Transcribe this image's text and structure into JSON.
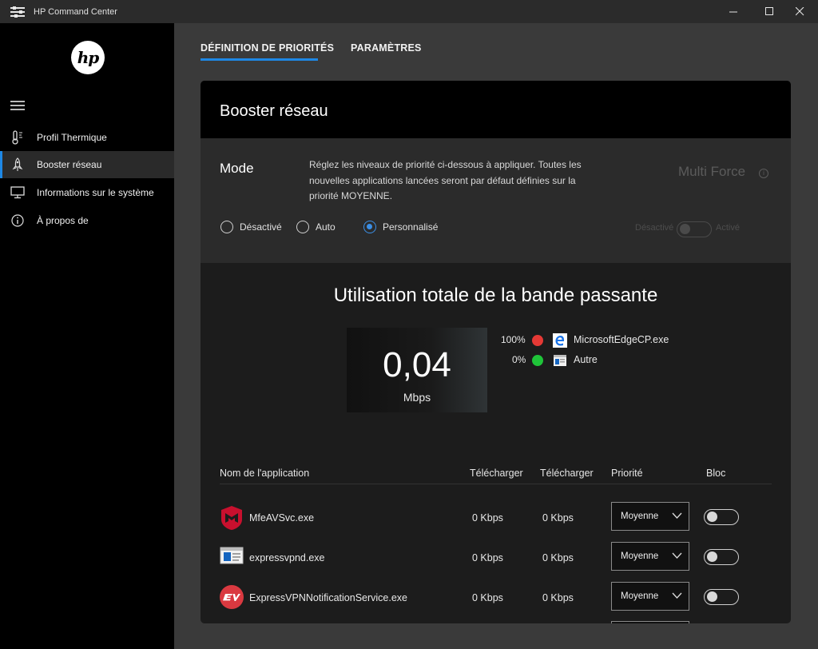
{
  "window": {
    "title": "HP Command Center"
  },
  "sidebar": {
    "logo_text": "hp",
    "items": [
      {
        "label": "Profil Thermique",
        "icon": "thermometer-icon"
      },
      {
        "label": "Booster réseau",
        "icon": "rocket-icon"
      },
      {
        "label": "Informations sur le système",
        "icon": "monitor-icon"
      },
      {
        "label": "À propos de",
        "icon": "info-icon"
      }
    ]
  },
  "tabs": [
    {
      "label": "DÉFINITION DE PRIORITÉS",
      "active": true
    },
    {
      "label": "PARAMÈTRES",
      "active": false
    }
  ],
  "card": {
    "title": "Booster réseau",
    "mode": {
      "title": "Mode",
      "description": "Réglez les niveaux de priorité ci-dessous à appliquer. Toutes les nouvelles applications lancées seront par défaut définies sur la priorité MOYENNE.",
      "options": [
        "Désactivé",
        "Auto",
        "Personnalisé"
      ],
      "selected": "Personnalisé"
    },
    "multi_force": {
      "title": "Multi Force",
      "off_label": "Désactivé",
      "on_label": "Activé",
      "info_glyph": "i"
    },
    "bandwidth": {
      "title": "Utilisation totale de la bande passante",
      "value": "0,04",
      "unit": "Mbps",
      "legend": [
        {
          "percent": "100%",
          "color": "#e53935",
          "name": "MicrosoftEdgeCP.exe",
          "icon": "edge-icon"
        },
        {
          "percent": "0%",
          "color": "#1fc439",
          "name": "Autre",
          "icon": "window-icon"
        }
      ]
    },
    "table": {
      "headers": [
        "Nom de l'application",
        "Télécharger",
        "Télécharger",
        "Priorité",
        "Bloc"
      ],
      "rows": [
        {
          "name": "MfeAVSvc.exe",
          "down": "0 Kbps",
          "up": "0 Kbps",
          "priority": "Moyenne",
          "icon": "mcafee-icon"
        },
        {
          "name": "expressvpnd.exe",
          "down": "0 Kbps",
          "up": "0 Kbps",
          "priority": "Moyenne",
          "icon": "window-icon"
        },
        {
          "name": "ExpressVPNNotificationService.exe",
          "down": "0 Kbps",
          "up": "0 Kbps",
          "priority": "Moyenne",
          "icon": "expressvpn-icon"
        }
      ]
    }
  }
}
